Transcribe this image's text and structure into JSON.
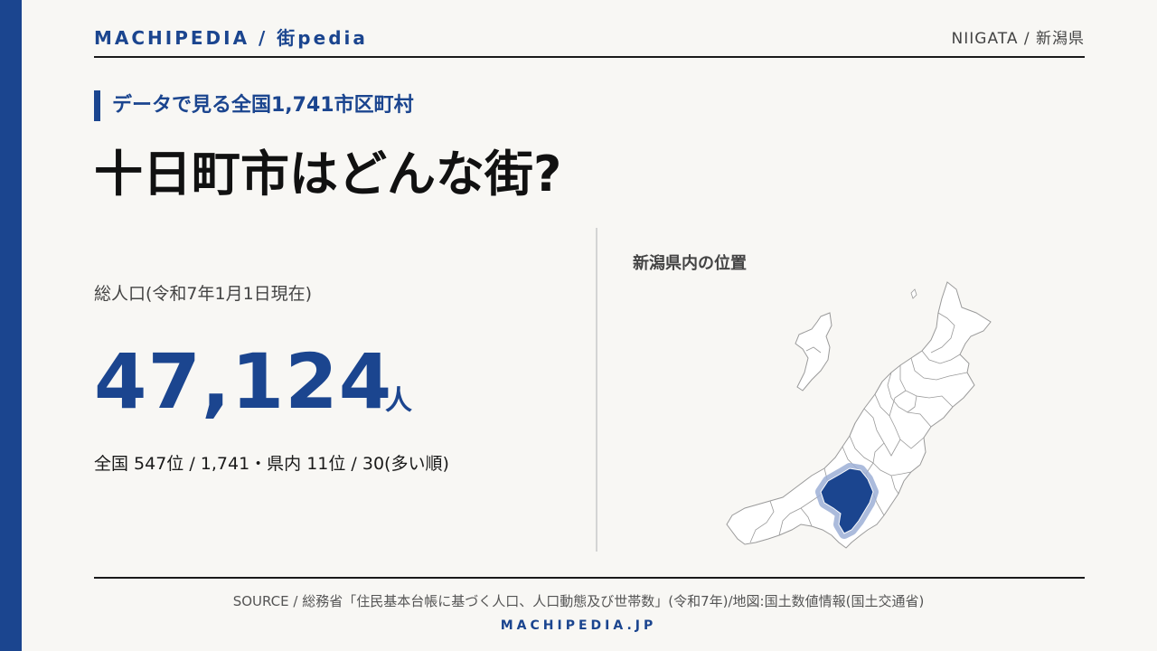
{
  "header": {
    "brand": "MACHIPEDIA / 街pedia",
    "region": "NIIGATA / 新潟県"
  },
  "subtitle": "データで見る全国1,741市区町村",
  "title": "十日町市はどんな街?",
  "population": {
    "label": "総人口(令和7年1月1日現在)",
    "value": "47,124",
    "unit": "人",
    "rank": "全国 547位 / 1,741・県内 11位 / 30(多い順)"
  },
  "map": {
    "title": "新潟県内の位置",
    "highlight_color": "#1b458f",
    "halo_color": "#9db0d6",
    "outline_color": "#9a9a9a"
  },
  "footer": {
    "source": "SOURCE / 総務省「住民基本台帳に基づく人口、人口動態及び世帯数」(令和7年)/地図:国土数値情報(国土交通省)",
    "brand": "MACHIPEDIA.JP"
  }
}
